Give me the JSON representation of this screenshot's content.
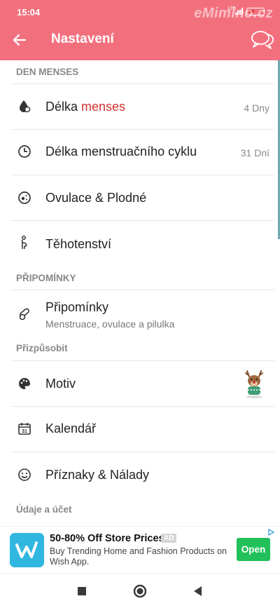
{
  "status_bar": {
    "time": "15:04",
    "watermark": "eMimino.cz",
    "signal_label": "LTE",
    "battery_level": 0.2
  },
  "app_bar": {
    "title": "Nastavení",
    "back_icon": "arrow-left-icon",
    "chat_icon": "chat-bubbles-icon"
  },
  "sections": {
    "menses": "DEN MENSES",
    "reminders": "PŘIPOMÍNKY",
    "customize": "Přizpůsobit",
    "account": "Údaje a účet"
  },
  "items": {
    "period_length": {
      "label_prefix": "Délka ",
      "label_highlight": "menses",
      "value": "4 Dny",
      "icon": "drop-icon"
    },
    "cycle_length": {
      "label": "Délka menstruačního cyklu",
      "value": "31 Dní",
      "icon": "clock-icon"
    },
    "ovulation": {
      "label": "Ovulace & Plodné",
      "icon": "egg-cell-icon"
    },
    "pregnancy": {
      "label": "Těhotenství",
      "icon": "pregnant-icon"
    },
    "reminders": {
      "label": "Připomínky",
      "subtitle": "Menstruace, ovulace a pilulka",
      "icon": "pill-icon"
    },
    "theme": {
      "label": "Motiv",
      "icon": "palette-icon",
      "preview": "reindeer-theme-icon"
    },
    "calendar": {
      "label": "Kalendář",
      "icon": "calendar-icon",
      "icon_day": "31"
    },
    "symptoms": {
      "label": "Příznaky & Nálady",
      "icon": "smiley-icon"
    }
  },
  "ad": {
    "headline": "50-80% Off Store Prices",
    "tag": "AD",
    "body": "Buy Trending Home and Fashion Products on Wish App.",
    "button": "Open",
    "logo_letter": "w",
    "colors": {
      "logo": "#2fb7e0",
      "button": "#21c05a"
    }
  },
  "nav_bar": {
    "items": [
      "stop-icon",
      "home-icon",
      "back-triangle-icon"
    ]
  },
  "colors": {
    "accent": "#f2707e",
    "highlight": "#d32f2f"
  }
}
